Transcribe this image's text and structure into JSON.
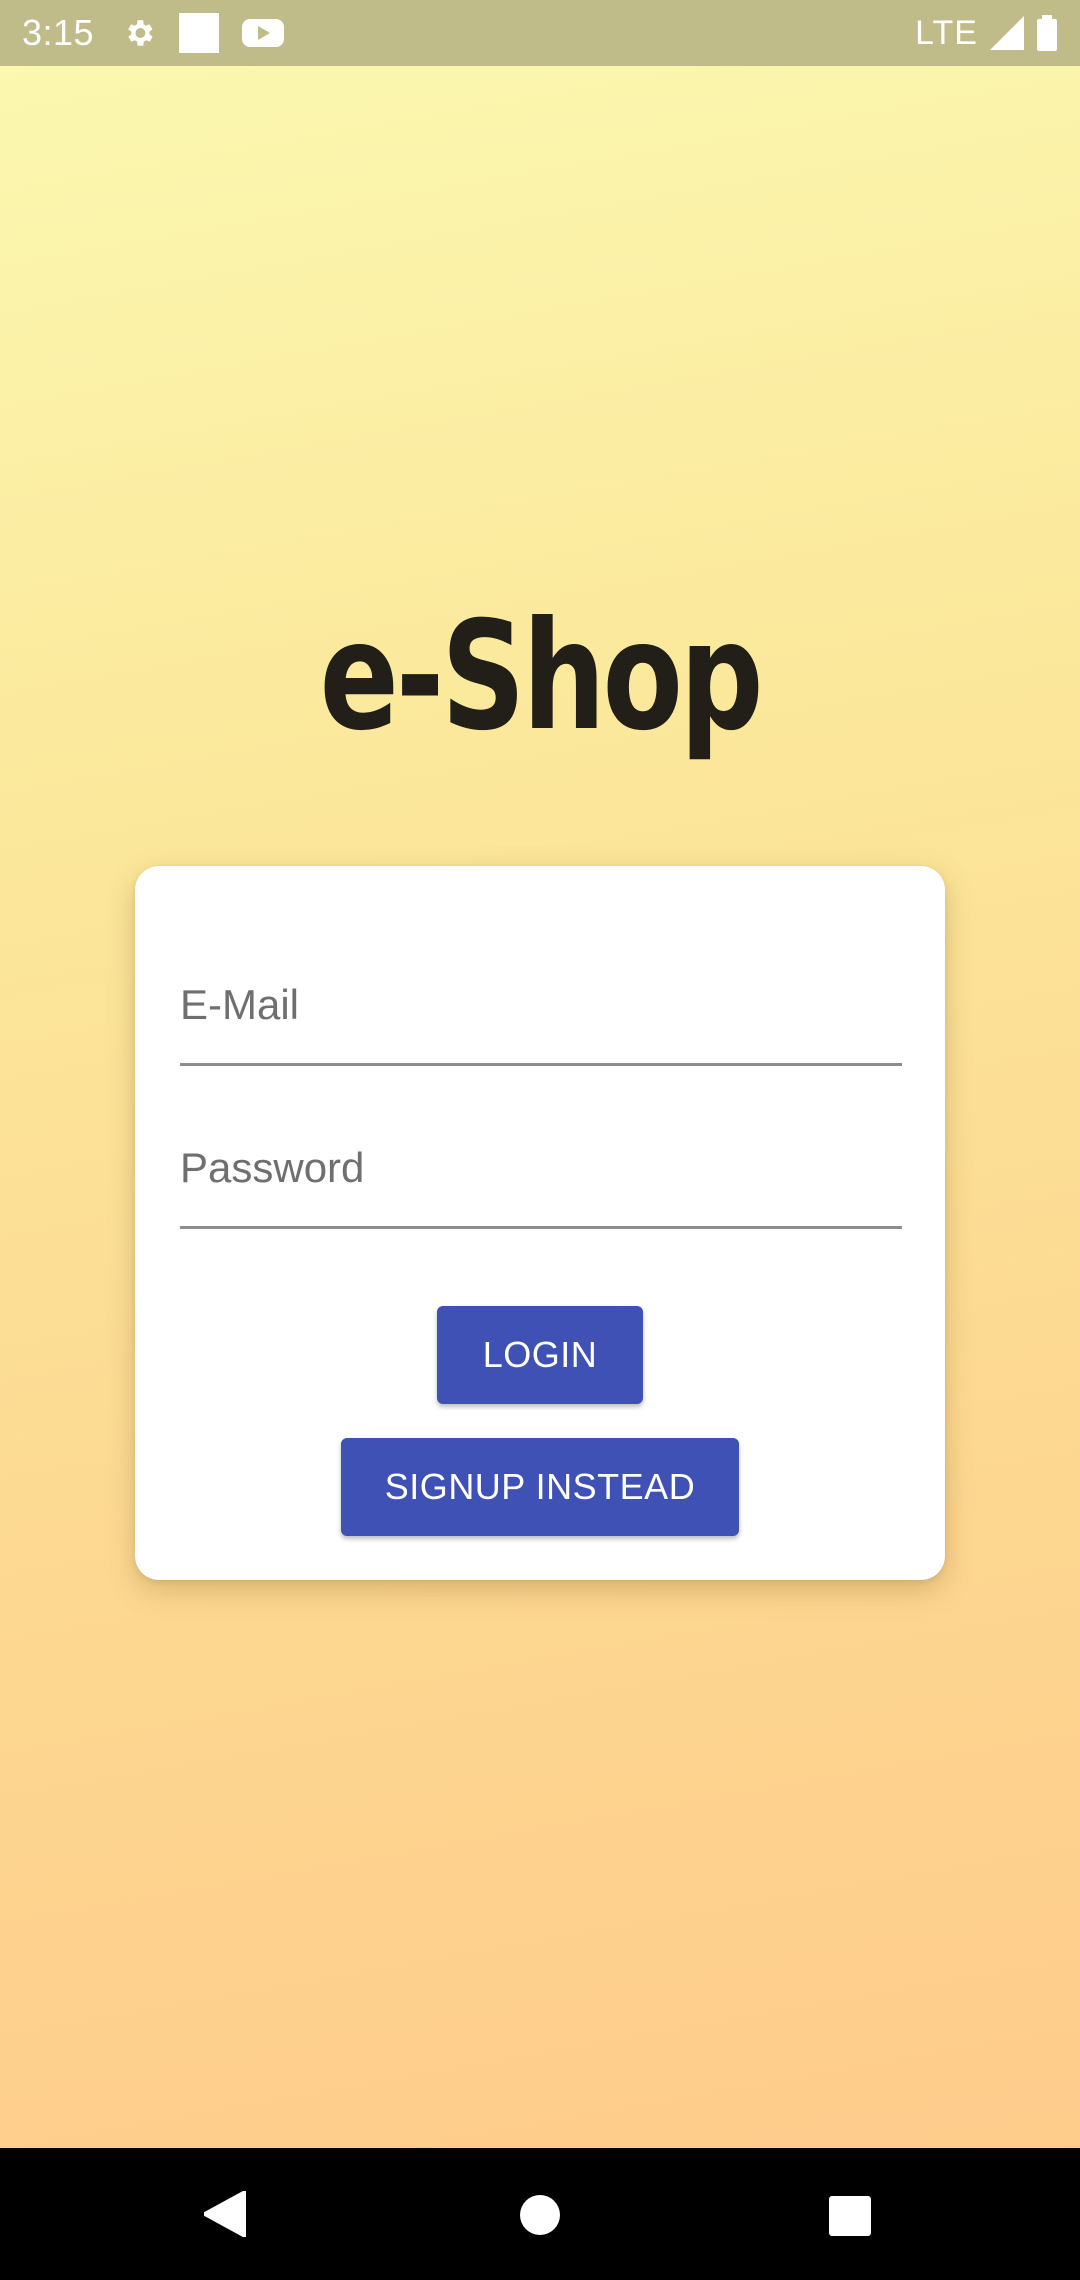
{
  "status_bar": {
    "time": "3:15",
    "network": "LTE",
    "icons": [
      "settings-icon",
      "square-icon",
      "youtube-icon",
      "signal-icon",
      "battery-icon"
    ]
  },
  "app": {
    "title": "e-Shop"
  },
  "login_form": {
    "email_placeholder": "E-Mail",
    "password_placeholder": "Password",
    "login_label": "LOGIN",
    "signup_label": "SIGNUP INSTEAD"
  },
  "nav_bar": {
    "icons": [
      "back-icon",
      "home-icon",
      "recents-icon"
    ]
  },
  "colors": {
    "primary": "#3f51b5",
    "status_bar": "#bfbc89",
    "title": "#211f17"
  }
}
